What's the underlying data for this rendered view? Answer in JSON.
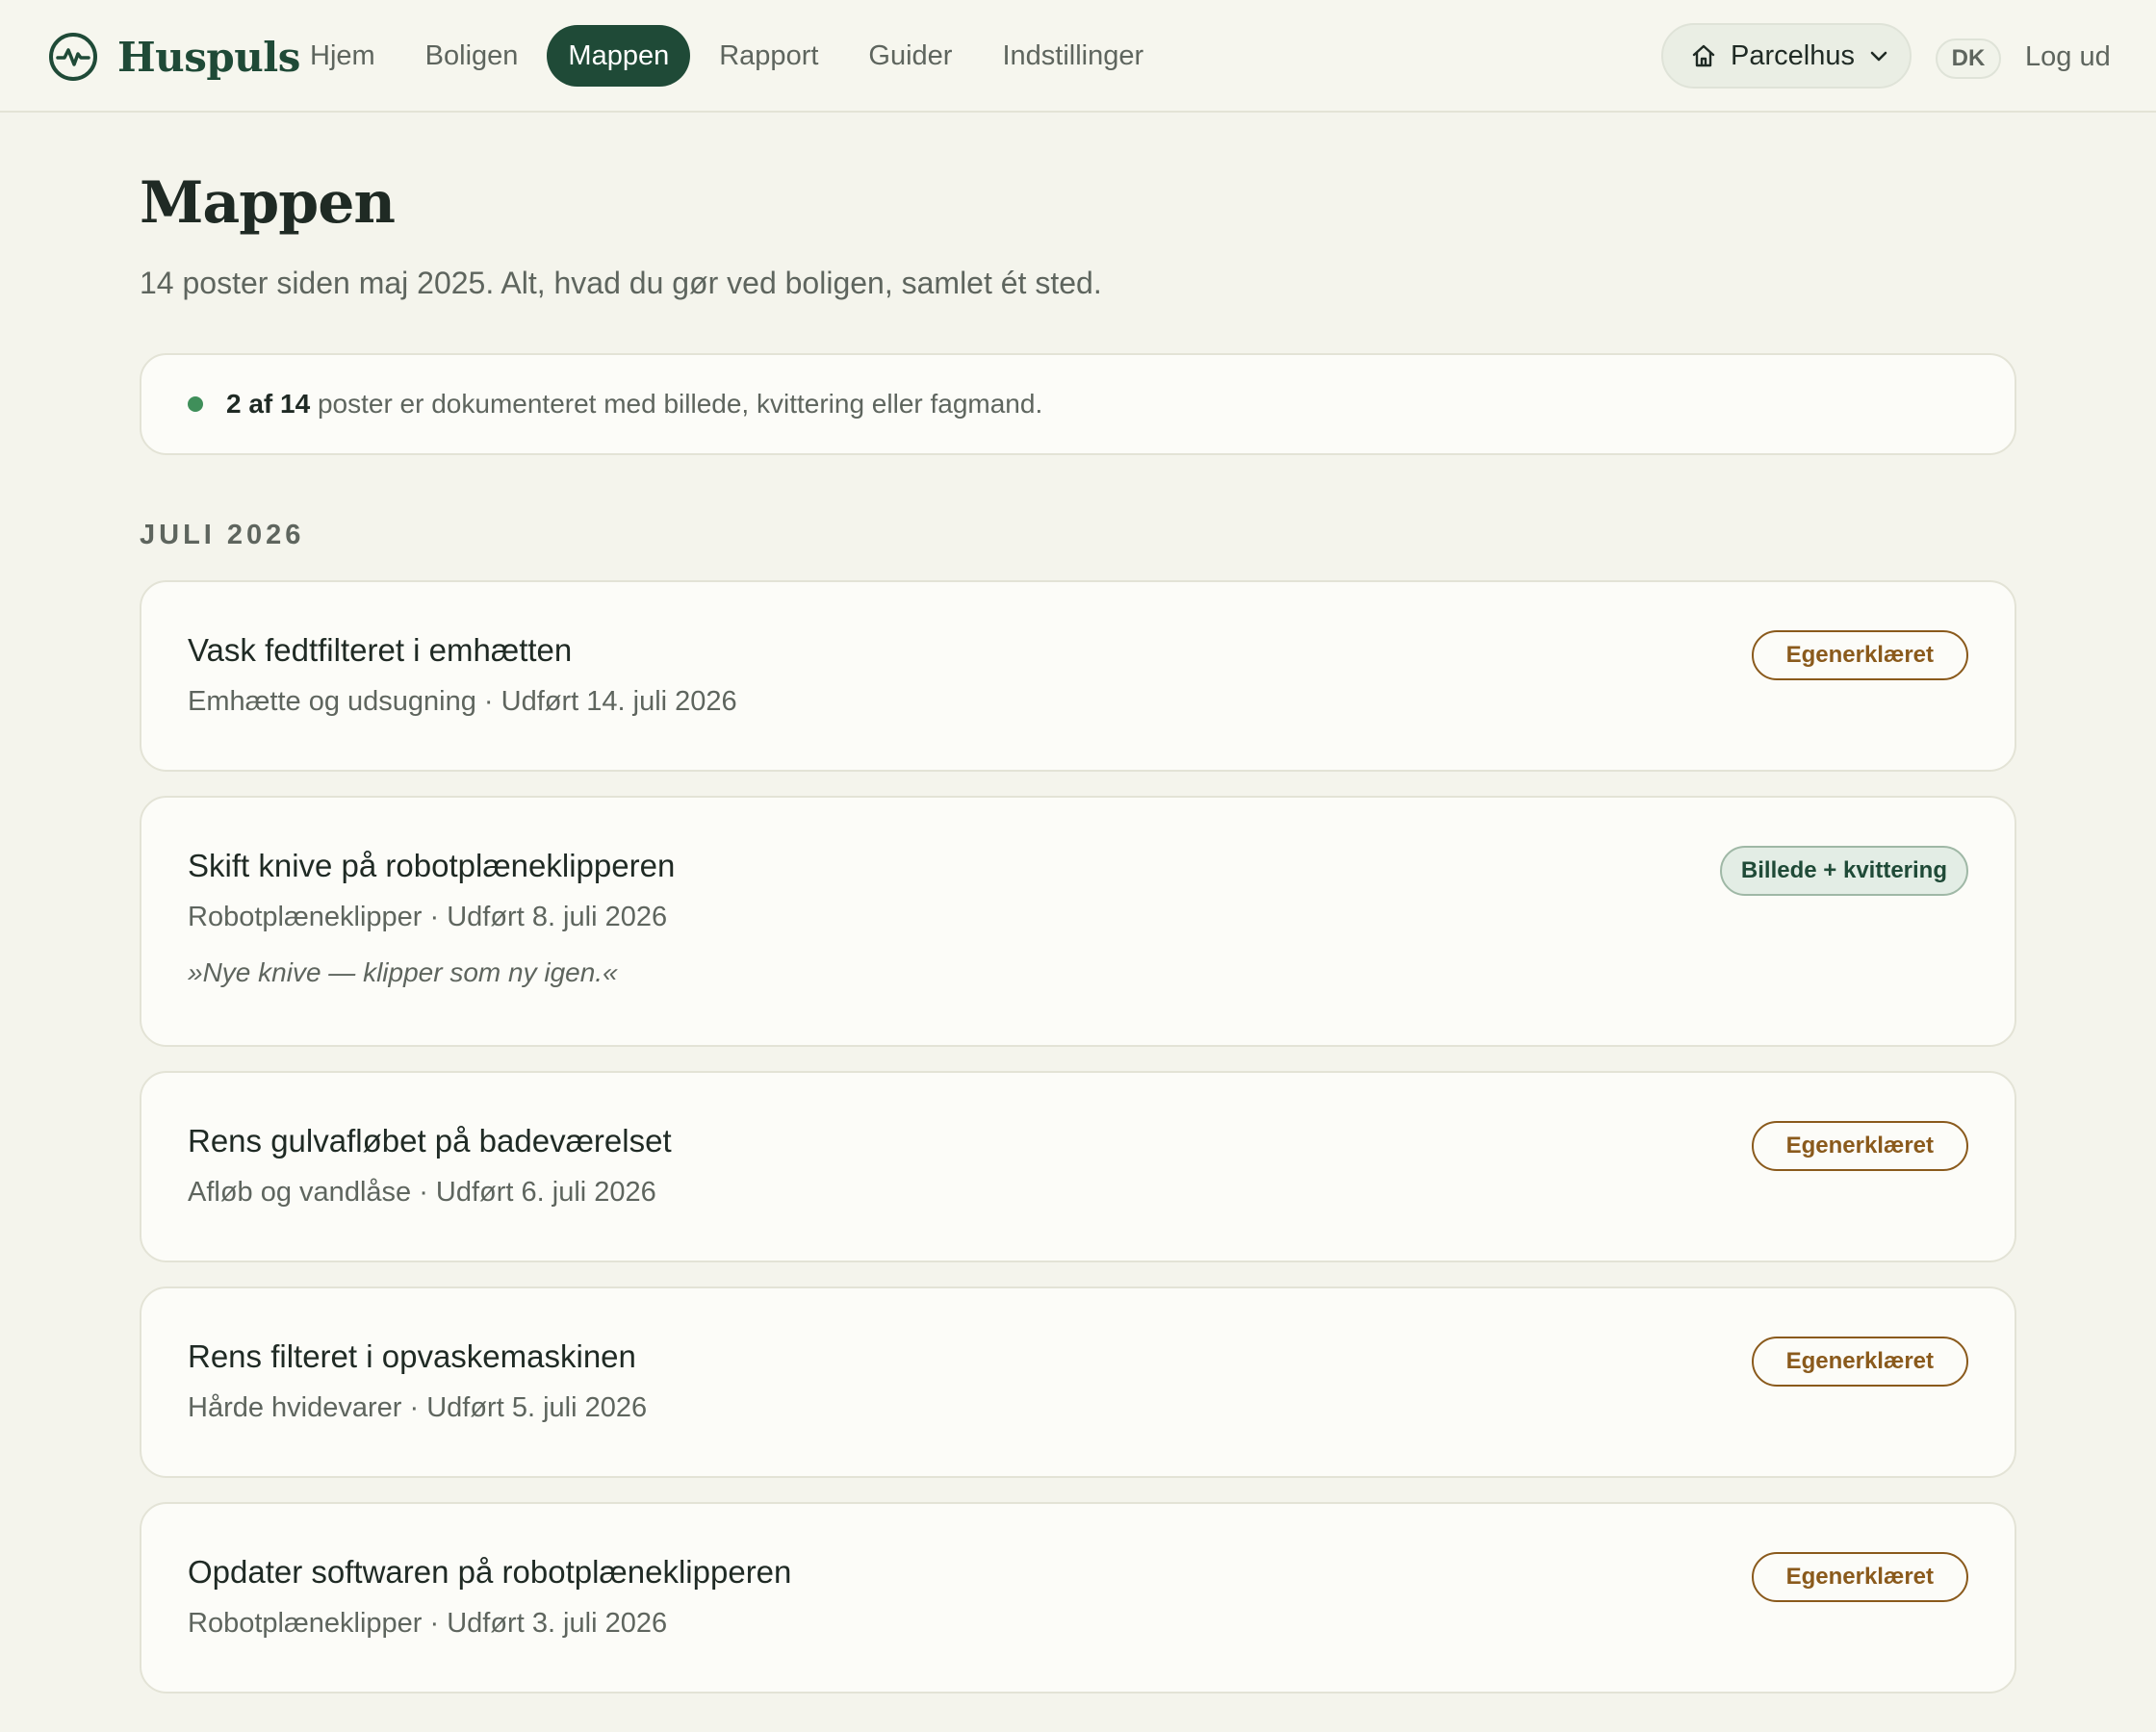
{
  "brand": {
    "name": "Huspuls"
  },
  "nav": {
    "items": [
      {
        "label": "Hjem",
        "active": false
      },
      {
        "label": "Boligen",
        "active": false
      },
      {
        "label": "Mappen",
        "active": true
      },
      {
        "label": "Rapport",
        "active": false
      },
      {
        "label": "Guider",
        "active": false
      },
      {
        "label": "Indstillinger",
        "active": false
      }
    ]
  },
  "header": {
    "house_select": "Parcelhus",
    "language": "DK",
    "logout": "Log ud"
  },
  "page": {
    "title": "Mappen",
    "subtitle": "14 poster siden maj 2025. Alt, hvad du gør ved boligen, samlet ét sted."
  },
  "documentation": {
    "count_text": "2 af 14",
    "text": "poster er dokumenteret med billede, kvittering eller fagmand."
  },
  "section": {
    "heading": "JULI 2026"
  },
  "entries": [
    {
      "title": "Vask fedtfilteret i emhætten",
      "meta": "Emhætte og udsugning · Udført 14. juli 2026",
      "badge": "Egenerklæret",
      "note": ""
    },
    {
      "title": "Skift knive på robotplæneklipperen",
      "meta": "Robotplæneklipper · Udført 8. juli 2026",
      "badge": "Billede + kvittering",
      "note": "»Nye knive — klipper som ny igen.«"
    },
    {
      "title": "Rens gulvafløbet på badeværelset",
      "meta": "Afløb og vandlåse · Udført 6. juli 2026",
      "badge": "Egenerklæret",
      "note": ""
    },
    {
      "title": "Rens filteret i opvaskemaskinen",
      "meta": "Hårde hvidevarer · Udført 5. juli 2026",
      "badge": "Egenerklæret",
      "note": ""
    },
    {
      "title": "Opdater softwaren på robotplæneklipperen",
      "meta": "Robotplæneklipper · Udført 3. juli 2026",
      "badge": "Egenerklæret",
      "note": ""
    }
  ],
  "colors": {
    "brand": "#1f4a37",
    "background": "#f4f4ec",
    "badge_self": "#8a5a1c",
    "badge_doc_bg": "#e3ede5",
    "status_dot": "#3f8f5a"
  },
  "icons": {
    "logo": "pulse-circle-icon",
    "house": "home-icon",
    "chevron": "chevron-down-icon"
  }
}
